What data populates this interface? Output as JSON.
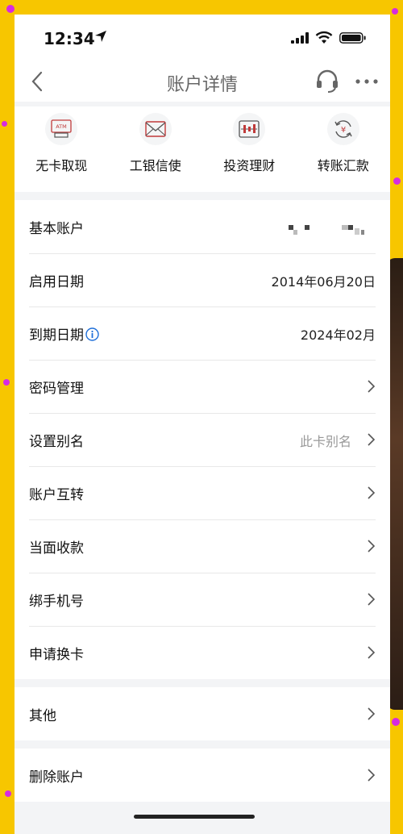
{
  "status_bar": {
    "time": "12:34"
  },
  "nav": {
    "title": "账户详情"
  },
  "quick_actions": [
    {
      "label": "无卡取现",
      "icon": "atm-icon"
    },
    {
      "label": "工银信使",
      "icon": "envelope-icon"
    },
    {
      "label": "投资理财",
      "icon": "invest-icon"
    },
    {
      "label": "转账汇款",
      "icon": "transfer-icon"
    }
  ],
  "atm_text": "ATM",
  "yuan_symbol": "¥",
  "account": {
    "basic_label": "基本账户",
    "start_label": "启用日期",
    "start_value": "2014年06月20日",
    "expire_label": "到期日期",
    "expire_value": "2024年02月"
  },
  "menu": {
    "password": "密码管理",
    "alias": "设置别名",
    "alias_hint": "此卡别名",
    "transfer": "账户互转",
    "collect": "当面收款",
    "bind_phone": "绑手机号",
    "replace_card": "申请换卡"
  },
  "other": "其他",
  "delete": "删除账户",
  "colors": {
    "accent": "#1e6fd9",
    "icon_red": "#c03a3a",
    "frame": "#f7c600"
  }
}
